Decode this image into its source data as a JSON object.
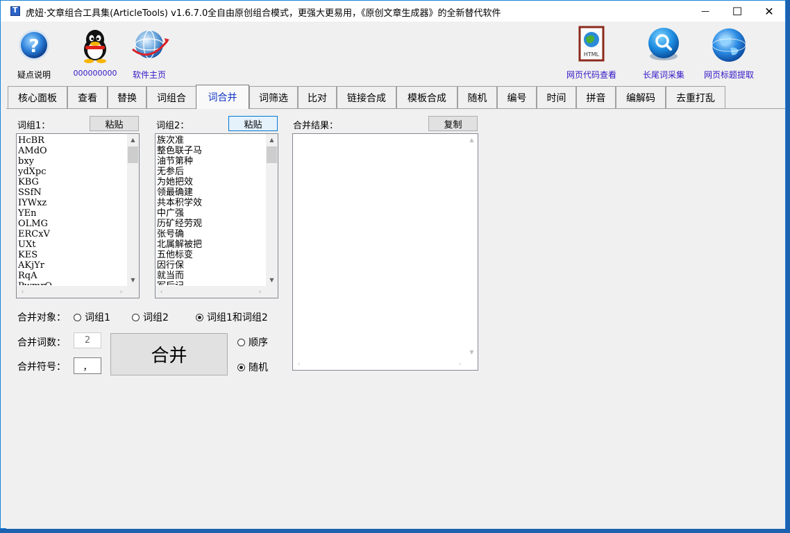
{
  "window": {
    "title": "虎妞·文章组合工具集(ArticleTools) v1.6.7.0",
    "slogan": "全自由原创组合模式，更强大更易用，《原创文章生成器》的全新替代软件",
    "controls": {
      "minimize": "—",
      "maximize": "☐",
      "close": "✕"
    }
  },
  "toolbar": {
    "left": [
      {
        "label": "疑点说明",
        "icon": "help-icon"
      },
      {
        "label": "000000000",
        "icon": "qq-penguin-icon"
      },
      {
        "label": "软件主页",
        "icon": "globe-icon"
      }
    ],
    "right": [
      {
        "label": "网页代码查看",
        "icon": "html-file-icon"
      },
      {
        "label": "长尾词采集",
        "icon": "search-icon"
      },
      {
        "label": "网页标题提取",
        "icon": "web-globe-icon"
      }
    ]
  },
  "tabs": [
    "核心面板",
    "查看",
    "替换",
    "词组合",
    "词合并",
    "词筛选",
    "比对",
    "链接合成",
    "模板合成",
    "随机",
    "编号",
    "时间",
    "拼音",
    "编解码",
    "去重打乱"
  ],
  "active_tab": "词合并",
  "panel": {
    "group1": {
      "label": "词组1：",
      "paste": "粘贴",
      "items": [
        "HcBR",
        "AMdO",
        "bxy",
        "ydXpc",
        "KBG",
        "SSfN",
        "IYWxz",
        "YEn",
        "OLMG",
        "ERCxV",
        "UXt",
        "KES",
        "AKjYr",
        "RqA",
        "PwmrO"
      ]
    },
    "group2": {
      "label": "词组2：",
      "paste": "粘贴",
      "items": [
        "族次准",
        "整色联子马",
        "油节第种",
        "无参后",
        "为她把效",
        "领最确建",
        "共本积学效",
        "中广强",
        "历矿经劳观",
        "张号确",
        "北属解被把",
        "五他标变",
        "因行保",
        "就当而",
        "军后记"
      ]
    },
    "result": {
      "label": "合并结果：",
      "copy": "复制"
    },
    "merge_target": {
      "label": "合并对象：",
      "options": [
        "词组1",
        "词组2",
        "词组1和词组2"
      ],
      "selected": "词组1和词组2"
    },
    "word_count": {
      "label": "合并词数：",
      "value": "2"
    },
    "separator": {
      "label": "合并符号：",
      "value": "，"
    },
    "merge_button": "合并",
    "order": {
      "options": [
        "顺序",
        "随机"
      ],
      "selected": "随机"
    }
  }
}
